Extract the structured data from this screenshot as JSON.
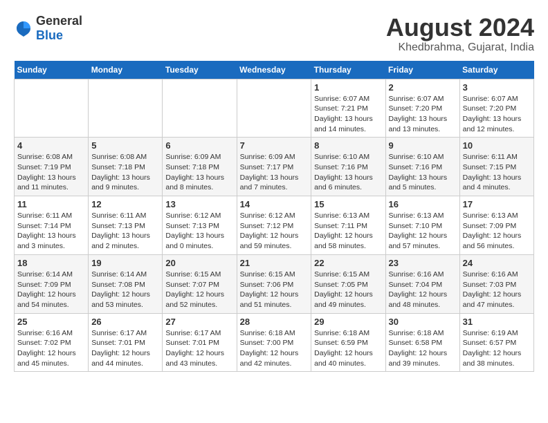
{
  "logo": {
    "general": "General",
    "blue": "Blue"
  },
  "title": {
    "month_year": "August 2024",
    "location": "Khedbrahma, Gujarat, India"
  },
  "days_of_week": [
    "Sunday",
    "Monday",
    "Tuesday",
    "Wednesday",
    "Thursday",
    "Friday",
    "Saturday"
  ],
  "weeks": [
    [
      {
        "day": "",
        "info": ""
      },
      {
        "day": "",
        "info": ""
      },
      {
        "day": "",
        "info": ""
      },
      {
        "day": "",
        "info": ""
      },
      {
        "day": "1",
        "info": "Sunrise: 6:07 AM\nSunset: 7:21 PM\nDaylight: 13 hours\nand 14 minutes."
      },
      {
        "day": "2",
        "info": "Sunrise: 6:07 AM\nSunset: 7:20 PM\nDaylight: 13 hours\nand 13 minutes."
      },
      {
        "day": "3",
        "info": "Sunrise: 6:07 AM\nSunset: 7:20 PM\nDaylight: 13 hours\nand 12 minutes."
      }
    ],
    [
      {
        "day": "4",
        "info": "Sunrise: 6:08 AM\nSunset: 7:19 PM\nDaylight: 13 hours\nand 11 minutes."
      },
      {
        "day": "5",
        "info": "Sunrise: 6:08 AM\nSunset: 7:18 PM\nDaylight: 13 hours\nand 9 minutes."
      },
      {
        "day": "6",
        "info": "Sunrise: 6:09 AM\nSunset: 7:18 PM\nDaylight: 13 hours\nand 8 minutes."
      },
      {
        "day": "7",
        "info": "Sunrise: 6:09 AM\nSunset: 7:17 PM\nDaylight: 13 hours\nand 7 minutes."
      },
      {
        "day": "8",
        "info": "Sunrise: 6:10 AM\nSunset: 7:16 PM\nDaylight: 13 hours\nand 6 minutes."
      },
      {
        "day": "9",
        "info": "Sunrise: 6:10 AM\nSunset: 7:16 PM\nDaylight: 13 hours\nand 5 minutes."
      },
      {
        "day": "10",
        "info": "Sunrise: 6:11 AM\nSunset: 7:15 PM\nDaylight: 13 hours\nand 4 minutes."
      }
    ],
    [
      {
        "day": "11",
        "info": "Sunrise: 6:11 AM\nSunset: 7:14 PM\nDaylight: 13 hours\nand 3 minutes."
      },
      {
        "day": "12",
        "info": "Sunrise: 6:11 AM\nSunset: 7:13 PM\nDaylight: 13 hours\nand 2 minutes."
      },
      {
        "day": "13",
        "info": "Sunrise: 6:12 AM\nSunset: 7:13 PM\nDaylight: 13 hours\nand 0 minutes."
      },
      {
        "day": "14",
        "info": "Sunrise: 6:12 AM\nSunset: 7:12 PM\nDaylight: 12 hours\nand 59 minutes."
      },
      {
        "day": "15",
        "info": "Sunrise: 6:13 AM\nSunset: 7:11 PM\nDaylight: 12 hours\nand 58 minutes."
      },
      {
        "day": "16",
        "info": "Sunrise: 6:13 AM\nSunset: 7:10 PM\nDaylight: 12 hours\nand 57 minutes."
      },
      {
        "day": "17",
        "info": "Sunrise: 6:13 AM\nSunset: 7:09 PM\nDaylight: 12 hours\nand 56 minutes."
      }
    ],
    [
      {
        "day": "18",
        "info": "Sunrise: 6:14 AM\nSunset: 7:09 PM\nDaylight: 12 hours\nand 54 minutes."
      },
      {
        "day": "19",
        "info": "Sunrise: 6:14 AM\nSunset: 7:08 PM\nDaylight: 12 hours\nand 53 minutes."
      },
      {
        "day": "20",
        "info": "Sunrise: 6:15 AM\nSunset: 7:07 PM\nDaylight: 12 hours\nand 52 minutes."
      },
      {
        "day": "21",
        "info": "Sunrise: 6:15 AM\nSunset: 7:06 PM\nDaylight: 12 hours\nand 51 minutes."
      },
      {
        "day": "22",
        "info": "Sunrise: 6:15 AM\nSunset: 7:05 PM\nDaylight: 12 hours\nand 49 minutes."
      },
      {
        "day": "23",
        "info": "Sunrise: 6:16 AM\nSunset: 7:04 PM\nDaylight: 12 hours\nand 48 minutes."
      },
      {
        "day": "24",
        "info": "Sunrise: 6:16 AM\nSunset: 7:03 PM\nDaylight: 12 hours\nand 47 minutes."
      }
    ],
    [
      {
        "day": "25",
        "info": "Sunrise: 6:16 AM\nSunset: 7:02 PM\nDaylight: 12 hours\nand 45 minutes."
      },
      {
        "day": "26",
        "info": "Sunrise: 6:17 AM\nSunset: 7:01 PM\nDaylight: 12 hours\nand 44 minutes."
      },
      {
        "day": "27",
        "info": "Sunrise: 6:17 AM\nSunset: 7:01 PM\nDaylight: 12 hours\nand 43 minutes."
      },
      {
        "day": "28",
        "info": "Sunrise: 6:18 AM\nSunset: 7:00 PM\nDaylight: 12 hours\nand 42 minutes."
      },
      {
        "day": "29",
        "info": "Sunrise: 6:18 AM\nSunset: 6:59 PM\nDaylight: 12 hours\nand 40 minutes."
      },
      {
        "day": "30",
        "info": "Sunrise: 6:18 AM\nSunset: 6:58 PM\nDaylight: 12 hours\nand 39 minutes."
      },
      {
        "day": "31",
        "info": "Sunrise: 6:19 AM\nSunset: 6:57 PM\nDaylight: 12 hours\nand 38 minutes."
      }
    ]
  ]
}
